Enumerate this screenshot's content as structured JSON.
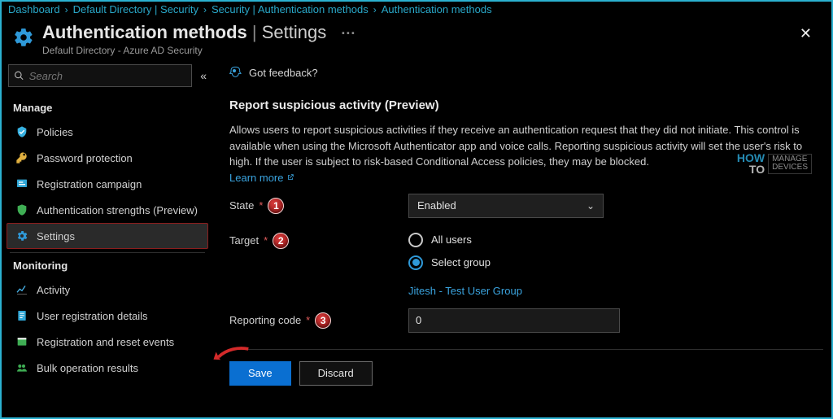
{
  "breadcrumb": [
    "Dashboard",
    "Default Directory | Security",
    "Security | Authentication methods",
    "Authentication methods"
  ],
  "header": {
    "title_main": "Authentication methods",
    "title_suffix": "Settings",
    "ellipsis": "···",
    "subtitle": "Default Directory - Azure AD Security"
  },
  "search": {
    "placeholder": "Search"
  },
  "sidebar": {
    "sections": {
      "manage_label": "Manage",
      "monitoring_label": "Monitoring"
    },
    "manage": [
      {
        "label": "Policies"
      },
      {
        "label": "Password protection"
      },
      {
        "label": "Registration campaign"
      },
      {
        "label": "Authentication strengths (Preview)"
      },
      {
        "label": "Settings"
      }
    ],
    "monitoring": [
      {
        "label": "Activity"
      },
      {
        "label": "User registration details"
      },
      {
        "label": "Registration and reset events"
      },
      {
        "label": "Bulk operation results"
      }
    ]
  },
  "feedback": {
    "label": "Got feedback?"
  },
  "content": {
    "title": "Report suspicious activity (Preview)",
    "description": "Allows users to report suspicious activities if they receive an authentication request that they did not initiate. This control is available when using the Microsoft Authenticator app and voice calls. Reporting suspicious activity will set the user's risk to high. If the user is subject to risk-based Conditional Access policies, they may be blocked.",
    "learn_more": "Learn more",
    "state_label": "State",
    "state_value": "Enabled",
    "target_label": "Target",
    "target_all": "All users",
    "target_select": "Select group",
    "target_group_link": "Jitesh - Test User Group",
    "reporting_label": "Reporting code",
    "reporting_value": "0",
    "required_mark": "*",
    "save_label": "Save",
    "discard_label": "Discard",
    "badges": {
      "state": "1",
      "target": "2",
      "reporting": "3"
    }
  },
  "watermark": {
    "how": "HOW",
    "to": "TO",
    "line1": "MANAGE",
    "line2": "DEVICES"
  },
  "icons": {
    "chevron": "›",
    "collapse": "«"
  }
}
